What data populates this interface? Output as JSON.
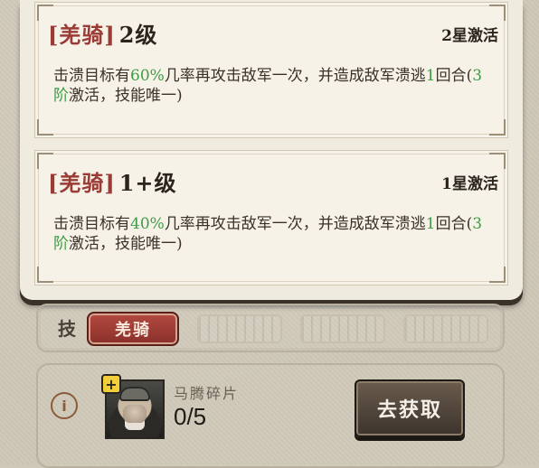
{
  "skills": [
    {
      "name": "羌骑",
      "level": "2级",
      "activation": "2星激活",
      "desc": {
        "before": "击溃目标有",
        "chance": "60%",
        "after_chance": "几率再攻击敌军一次，并造成敌军溃逃",
        "rounds": "1",
        "after_rounds": "回合(",
        "tier": "3阶",
        "end": "激活，技能唯一)"
      }
    },
    {
      "name": "羌骑",
      "level": "1+级",
      "activation": "1星激活",
      "desc": {
        "before": "击溃目标有",
        "chance": "40%",
        "after_chance": "几率再攻击敌军一次，并造成敌军溃逃",
        "rounds": "1",
        "after_rounds": "回合(",
        "tier": "3阶",
        "end": "激活，技能唯一)"
      }
    }
  ],
  "strip": {
    "label": "技",
    "active_tab": "羌骑"
  },
  "fragment": {
    "name": "马腾碎片",
    "count": "0/5",
    "obtain_label": "去获取",
    "info_symbol": "i",
    "plus_symbol": "+"
  },
  "colors": {
    "skill_name": "#9b3b35",
    "highlight": "#3f9c46",
    "tab_bg": "#8a2f2a",
    "button_bg": "#3c332b",
    "panel_bg": "#f0ebdf"
  },
  "icons": {
    "info": "info-icon",
    "plus": "plus-icon",
    "portrait": "general-portrait"
  }
}
